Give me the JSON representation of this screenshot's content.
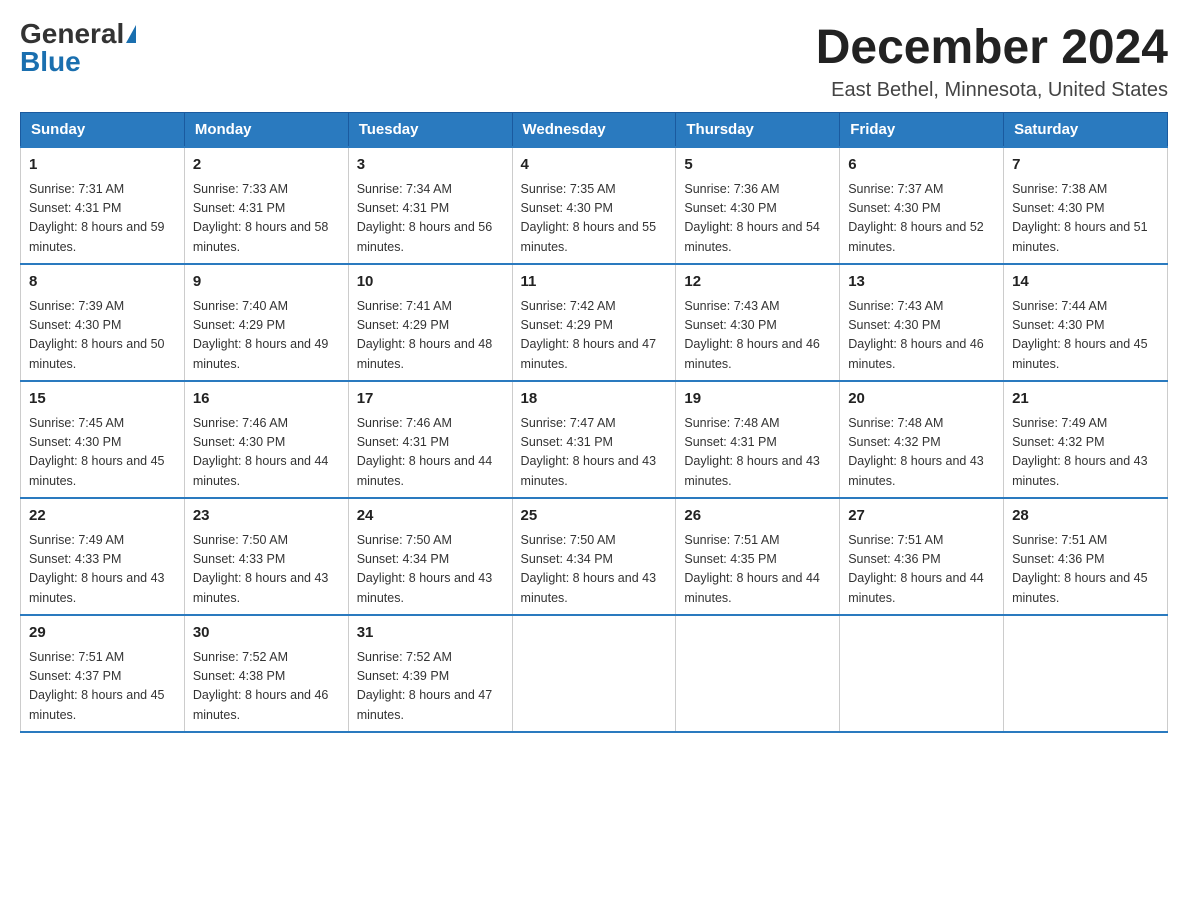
{
  "header": {
    "logo_general": "General",
    "logo_blue": "Blue",
    "month_title": "December 2024",
    "location": "East Bethel, Minnesota, United States"
  },
  "days_of_week": [
    "Sunday",
    "Monday",
    "Tuesday",
    "Wednesday",
    "Thursday",
    "Friday",
    "Saturday"
  ],
  "weeks": [
    [
      {
        "day": 1,
        "sunrise": "7:31 AM",
        "sunset": "4:31 PM",
        "daylight": "8 hours and 59 minutes."
      },
      {
        "day": 2,
        "sunrise": "7:33 AM",
        "sunset": "4:31 PM",
        "daylight": "8 hours and 58 minutes."
      },
      {
        "day": 3,
        "sunrise": "7:34 AM",
        "sunset": "4:31 PM",
        "daylight": "8 hours and 56 minutes."
      },
      {
        "day": 4,
        "sunrise": "7:35 AM",
        "sunset": "4:30 PM",
        "daylight": "8 hours and 55 minutes."
      },
      {
        "day": 5,
        "sunrise": "7:36 AM",
        "sunset": "4:30 PM",
        "daylight": "8 hours and 54 minutes."
      },
      {
        "day": 6,
        "sunrise": "7:37 AM",
        "sunset": "4:30 PM",
        "daylight": "8 hours and 52 minutes."
      },
      {
        "day": 7,
        "sunrise": "7:38 AM",
        "sunset": "4:30 PM",
        "daylight": "8 hours and 51 minutes."
      }
    ],
    [
      {
        "day": 8,
        "sunrise": "7:39 AM",
        "sunset": "4:30 PM",
        "daylight": "8 hours and 50 minutes."
      },
      {
        "day": 9,
        "sunrise": "7:40 AM",
        "sunset": "4:29 PM",
        "daylight": "8 hours and 49 minutes."
      },
      {
        "day": 10,
        "sunrise": "7:41 AM",
        "sunset": "4:29 PM",
        "daylight": "8 hours and 48 minutes."
      },
      {
        "day": 11,
        "sunrise": "7:42 AM",
        "sunset": "4:29 PM",
        "daylight": "8 hours and 47 minutes."
      },
      {
        "day": 12,
        "sunrise": "7:43 AM",
        "sunset": "4:30 PM",
        "daylight": "8 hours and 46 minutes."
      },
      {
        "day": 13,
        "sunrise": "7:43 AM",
        "sunset": "4:30 PM",
        "daylight": "8 hours and 46 minutes."
      },
      {
        "day": 14,
        "sunrise": "7:44 AM",
        "sunset": "4:30 PM",
        "daylight": "8 hours and 45 minutes."
      }
    ],
    [
      {
        "day": 15,
        "sunrise": "7:45 AM",
        "sunset": "4:30 PM",
        "daylight": "8 hours and 45 minutes."
      },
      {
        "day": 16,
        "sunrise": "7:46 AM",
        "sunset": "4:30 PM",
        "daylight": "8 hours and 44 minutes."
      },
      {
        "day": 17,
        "sunrise": "7:46 AM",
        "sunset": "4:31 PM",
        "daylight": "8 hours and 44 minutes."
      },
      {
        "day": 18,
        "sunrise": "7:47 AM",
        "sunset": "4:31 PM",
        "daylight": "8 hours and 43 minutes."
      },
      {
        "day": 19,
        "sunrise": "7:48 AM",
        "sunset": "4:31 PM",
        "daylight": "8 hours and 43 minutes."
      },
      {
        "day": 20,
        "sunrise": "7:48 AM",
        "sunset": "4:32 PM",
        "daylight": "8 hours and 43 minutes."
      },
      {
        "day": 21,
        "sunrise": "7:49 AM",
        "sunset": "4:32 PM",
        "daylight": "8 hours and 43 minutes."
      }
    ],
    [
      {
        "day": 22,
        "sunrise": "7:49 AM",
        "sunset": "4:33 PM",
        "daylight": "8 hours and 43 minutes."
      },
      {
        "day": 23,
        "sunrise": "7:50 AM",
        "sunset": "4:33 PM",
        "daylight": "8 hours and 43 minutes."
      },
      {
        "day": 24,
        "sunrise": "7:50 AM",
        "sunset": "4:34 PM",
        "daylight": "8 hours and 43 minutes."
      },
      {
        "day": 25,
        "sunrise": "7:50 AM",
        "sunset": "4:34 PM",
        "daylight": "8 hours and 43 minutes."
      },
      {
        "day": 26,
        "sunrise": "7:51 AM",
        "sunset": "4:35 PM",
        "daylight": "8 hours and 44 minutes."
      },
      {
        "day": 27,
        "sunrise": "7:51 AM",
        "sunset": "4:36 PM",
        "daylight": "8 hours and 44 minutes."
      },
      {
        "day": 28,
        "sunrise": "7:51 AM",
        "sunset": "4:36 PM",
        "daylight": "8 hours and 45 minutes."
      }
    ],
    [
      {
        "day": 29,
        "sunrise": "7:51 AM",
        "sunset": "4:37 PM",
        "daylight": "8 hours and 45 minutes."
      },
      {
        "day": 30,
        "sunrise": "7:52 AM",
        "sunset": "4:38 PM",
        "daylight": "8 hours and 46 minutes."
      },
      {
        "day": 31,
        "sunrise": "7:52 AM",
        "sunset": "4:39 PM",
        "daylight": "8 hours and 47 minutes."
      },
      null,
      null,
      null,
      null
    ]
  ]
}
